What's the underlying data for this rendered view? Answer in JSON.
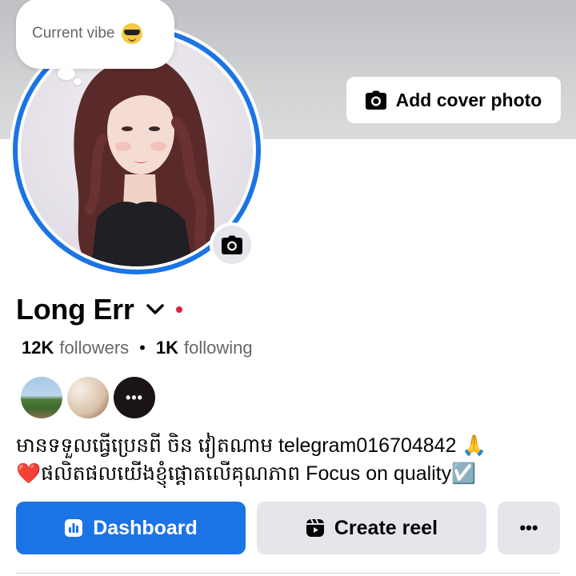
{
  "cover": {
    "add_cover_label": "Add cover photo"
  },
  "vibe": {
    "text": "Current vibe",
    "emoji": "smiling-face-with-sunglasses"
  },
  "profile": {
    "name": "Long Err",
    "followers_count": "12K",
    "followers_label": "followers",
    "following_count": "1K",
    "following_label": "following",
    "separator": "•",
    "more_friends": "•••"
  },
  "bio": {
    "line1": "មានទទួលធ្វើប្រេនពី ចិន វៀតណាម telegram016704842 🙏",
    "line2": "❤️ផលិតផលយើងខ្ញុំផ្តោតលើគុណភាព Focus on quality☑️"
  },
  "actions": {
    "dashboard_label": "Dashboard",
    "create_reel_label": "Create reel",
    "more_label": "•••"
  },
  "colors": {
    "accent": "#1b74e4",
    "online_dot": "#e41e3f",
    "secondary_button": "#e4e6eb"
  },
  "icons": {
    "camera": "camera-icon",
    "chevron": "chevron-down-icon",
    "dashboard": "dashboard-icon",
    "reel": "reel-icon"
  }
}
